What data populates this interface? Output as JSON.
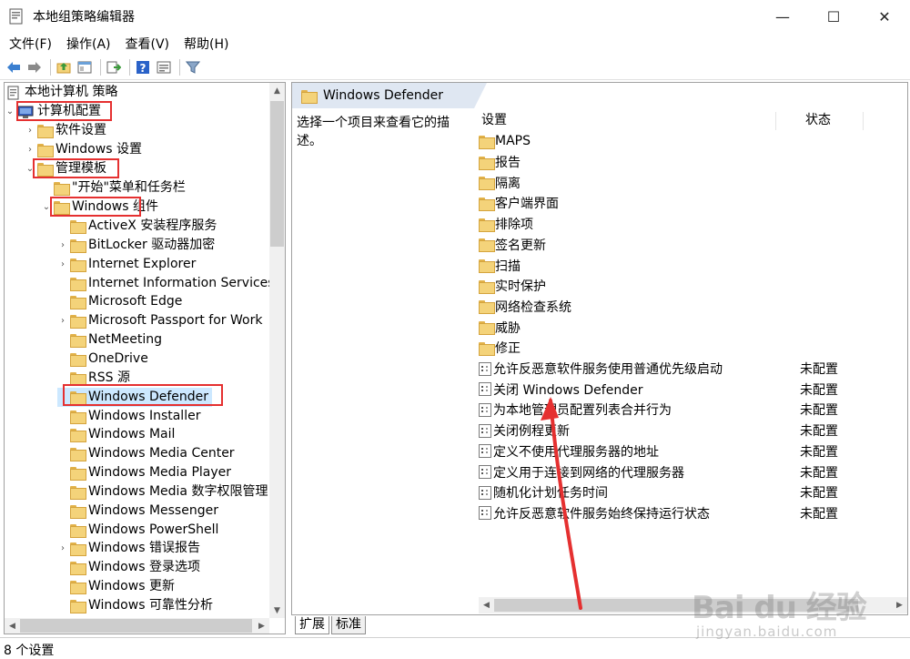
{
  "window": {
    "title": "本地组策略编辑器",
    "minimize": "—",
    "maximize": "☐",
    "close": "✕"
  },
  "menu": [
    "文件(F)",
    "操作(A)",
    "查看(V)",
    "帮助(H)"
  ],
  "toolbar_icons": [
    "back-icon",
    "forward-icon",
    "up-folder-icon",
    "show-tree-icon",
    "export-icon",
    "help-icon",
    "properties-icon",
    "filter-icon"
  ],
  "tree": {
    "root": "本地计算机 策略",
    "computer_config": "计算机配置",
    "software_settings": "软件设置",
    "windows_settings": "Windows 设置",
    "admin_templates": "管理模板",
    "start_menu": "\"开始\"菜单和任务栏",
    "windows_components": "Windows 组件",
    "components": [
      "ActiveX 安装程序服务",
      "BitLocker 驱动器加密",
      "Internet Explorer",
      "Internet Information Services",
      "Microsoft Edge",
      "Microsoft Passport for Work",
      "NetMeeting",
      "OneDrive",
      "RSS 源",
      "Windows Defender",
      "Windows Installer",
      "Windows Mail",
      "Windows Media Center",
      "Windows Media Player",
      "Windows Media 数字权限管理",
      "Windows Messenger",
      "Windows PowerShell",
      "Windows 错误报告",
      "Windows 登录选项",
      "Windows 更新",
      "Windows 可靠性分析"
    ]
  },
  "right": {
    "header": "Windows Defender",
    "description": "选择一个项目来查看它的描述。",
    "col_setting": "设置",
    "col_state": "状态",
    "folders": [
      "MAPS",
      "报告",
      "隔离",
      "客户端界面",
      "排除项",
      "签名更新",
      "扫描",
      "实时保护",
      "网络检查系统",
      "威胁",
      "修正"
    ],
    "settings": [
      {
        "name": "允许反恶意软件服务使用普通优先级启动",
        "state": "未配置"
      },
      {
        "name": "关闭 Windows Defender",
        "state": "未配置"
      },
      {
        "name": "为本地管理员配置列表合并行为",
        "state": "未配置"
      },
      {
        "name": "关闭例程更新",
        "state": "未配置"
      },
      {
        "name": "定义不使用代理服务器的地址",
        "state": "未配置"
      },
      {
        "name": "定义用于连接到网络的代理服务器",
        "state": "未配置"
      },
      {
        "name": "随机化计划任务时间",
        "state": "未配置"
      },
      {
        "name": "允许反恶意软件服务始终保持运行状态",
        "state": "未配置"
      }
    ]
  },
  "tabs": [
    "扩展",
    "标准"
  ],
  "status": "8 个设置",
  "watermark": {
    "brand": "Bai du 经验",
    "url": "jingyan.baidu.com"
  },
  "colors": {
    "highlight": "#e53030",
    "selection": "#cce8ff",
    "header_bg": "#dfe7f2"
  }
}
